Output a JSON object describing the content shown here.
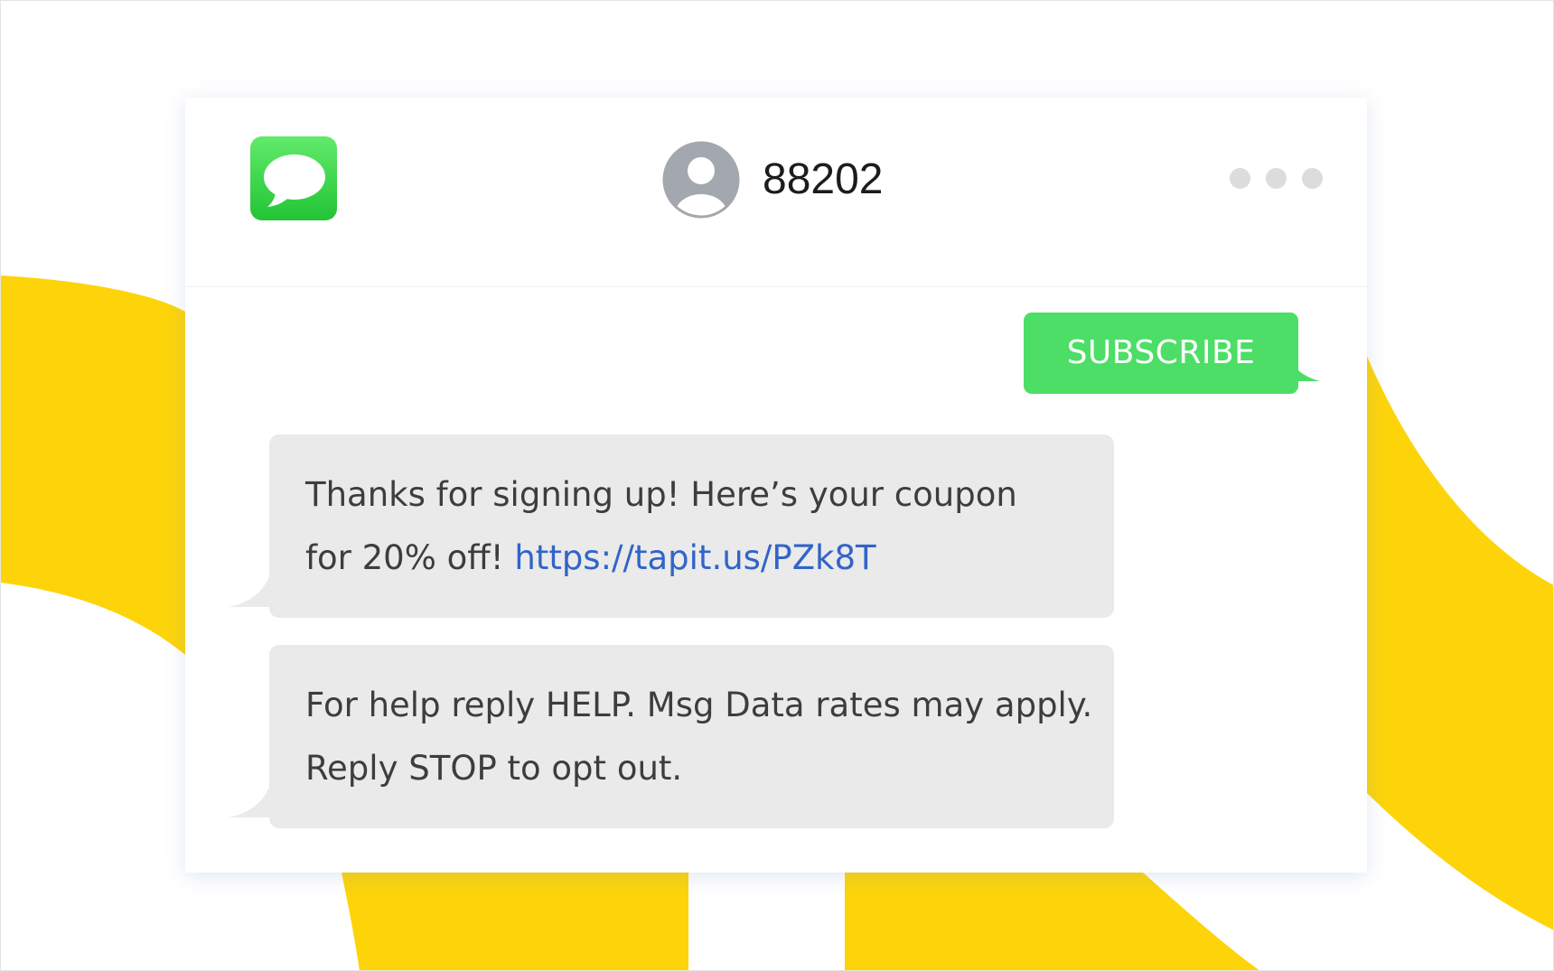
{
  "colors": {
    "accent_yellow": "#fdd40a",
    "sent_bubble": "#4cde66",
    "received_bubble": "#eaeaea",
    "link": "#3264c8",
    "app_icon_green": "#22c435"
  },
  "header": {
    "app_icon": "messages-icon",
    "contact_avatar_icon": "person-avatar-icon",
    "contact_number": "88202",
    "more_icon": "ellipsis-icon"
  },
  "messages": [
    {
      "direction": "outgoing",
      "text": "SUBSCRIBE"
    },
    {
      "direction": "incoming",
      "line1": "Thanks for signing up! Here’s your coupon",
      "line2_prefix": "for 20% off! ",
      "link": "https://tapit.us/PZk8T"
    },
    {
      "direction": "incoming",
      "line1": "For help reply HELP. Msg Data rates may apply.",
      "line2": "Reply STOP to opt out."
    }
  ]
}
